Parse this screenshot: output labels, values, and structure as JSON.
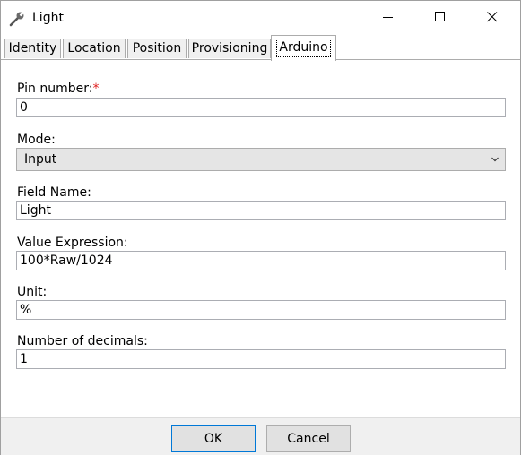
{
  "window": {
    "title": "Light",
    "icon": "wrench-icon"
  },
  "tabs": [
    {
      "label": "Identity",
      "active": false
    },
    {
      "label": "Location",
      "active": false
    },
    {
      "label": "Position",
      "active": false
    },
    {
      "label": "Provisioning",
      "active": false
    },
    {
      "label": "Arduino",
      "active": true
    }
  ],
  "form": {
    "pin_number": {
      "label": "Pin number:",
      "required_mark": "*",
      "value": "0"
    },
    "mode": {
      "label": "Mode:",
      "selected": "Input"
    },
    "field_name": {
      "label": "Field Name:",
      "value": "Light"
    },
    "value_expression": {
      "label": "Value Expression:",
      "value": "100*Raw/1024"
    },
    "unit": {
      "label": "Unit:",
      "value": "%"
    },
    "decimals": {
      "label": "Number of decimals:",
      "value": "1"
    }
  },
  "buttons": {
    "ok": "OK",
    "cancel": "Cancel"
  },
  "colors": {
    "required": "#e02020",
    "default_button_border": "#0078d7"
  }
}
